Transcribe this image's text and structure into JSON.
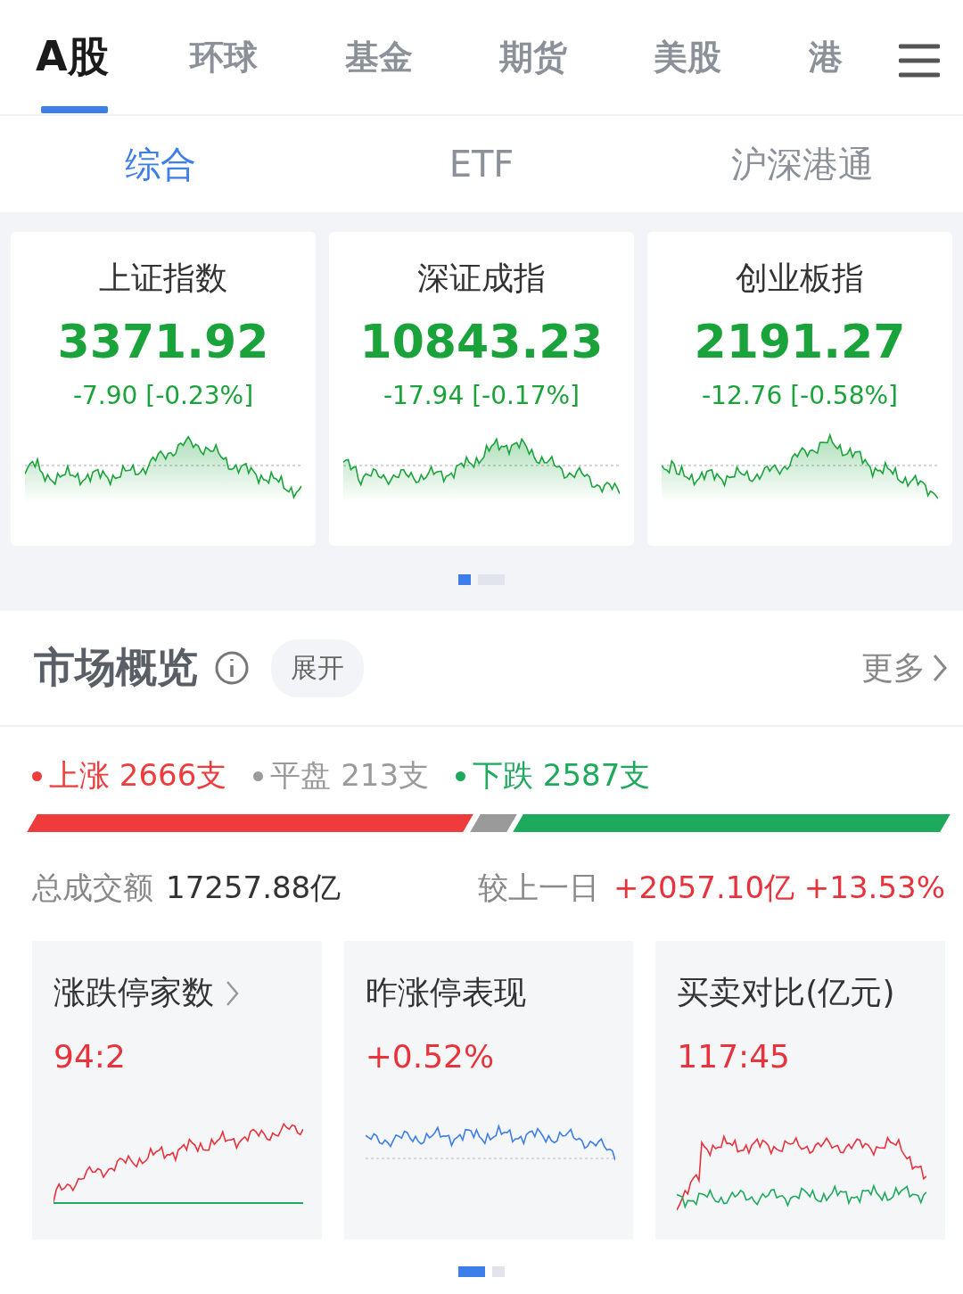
{
  "market_tabs": [
    {
      "label": "A股",
      "selected": true
    },
    {
      "label": "环球",
      "selected": false
    },
    {
      "label": "基金",
      "selected": false
    },
    {
      "label": "期货",
      "selected": false
    },
    {
      "label": "美股",
      "selected": false
    },
    {
      "label": "港",
      "selected": false
    }
  ],
  "sub_tabs": [
    {
      "label": "综合",
      "selected": true
    },
    {
      "label": "ETF",
      "selected": false
    },
    {
      "label": "沪深港通",
      "selected": false
    }
  ],
  "index_cards": [
    {
      "name": "上证指数",
      "value": "3371.92",
      "change": "-7.90 [-0.23%]"
    },
    {
      "name": "深证成指",
      "value": "10843.23",
      "change": "-17.94 [-0.17%]"
    },
    {
      "name": "创业板指",
      "value": "2191.27",
      "change": "-12.76 [-0.58%]"
    }
  ],
  "index_pages": [
    {
      "selected": true
    },
    {
      "selected": false
    }
  ],
  "overview": {
    "title": "市场概览",
    "expand_button": "展开",
    "more_link": "更多",
    "legend": [
      {
        "label": "上涨 2666支",
        "color": "#ee3b3b"
      },
      {
        "label": "平盘 213支",
        "color": "#9a9a9a"
      },
      {
        "label": "下跌 2587支",
        "color": "#1eaa5c"
      }
    ],
    "turnover_label": "总成交额",
    "turnover_value": "17257.88亿",
    "compare_label": "较上一日",
    "compare_value": "+2057.10亿 +13.53%"
  },
  "stat_cards": [
    {
      "title": "涨跌停家数",
      "has_arrow": true,
      "value": "94:2"
    },
    {
      "title": "昨涨停表现",
      "has_arrow": false,
      "value": "+0.52%"
    },
    {
      "title": "买卖对比(亿元)",
      "has_arrow": false,
      "value": "117:45"
    }
  ],
  "stat_pages": [
    {
      "selected": true
    },
    {
      "selected": false
    }
  ]
}
